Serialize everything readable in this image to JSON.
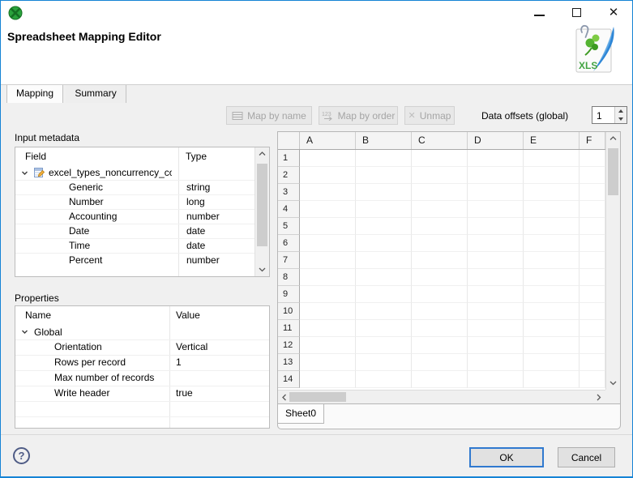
{
  "window": {
    "icons": {
      "app": "clover-app-icon",
      "minimize": "minimize-icon",
      "maximize": "maximize-icon",
      "close": "close-icon"
    },
    "close_glyph": "✕"
  },
  "header": {
    "title": "Spreadsheet Mapping Editor",
    "file_icon_label": "XLS"
  },
  "tabs": {
    "mapping": "Mapping",
    "summary": "Summary"
  },
  "toolbar": {
    "map_by_name": "Map by name",
    "map_by_order": "Map by order",
    "unmap": "Unmap",
    "unmap_glyph": "✕",
    "data_offsets_label": "Data offsets (global)",
    "data_offsets_value": "1"
  },
  "input_metadata": {
    "section_label": "Input metadata",
    "columns": {
      "field": "Field",
      "type": "Type"
    },
    "record_name": "excel_types_noncurrency_con",
    "fields": [
      {
        "field": "Generic",
        "type": "string"
      },
      {
        "field": "Number",
        "type": "long"
      },
      {
        "field": "Accounting",
        "type": "number"
      },
      {
        "field": "Date",
        "type": "date"
      },
      {
        "field": "Time",
        "type": "date"
      },
      {
        "field": "Percent",
        "type": "number"
      }
    ]
  },
  "properties": {
    "section_label": "Properties",
    "columns": {
      "name": "Name",
      "value": "Value"
    },
    "group": "Global",
    "rows": [
      {
        "name": "Orientation",
        "value": "Vertical"
      },
      {
        "name": "Rows per record",
        "value": "1"
      },
      {
        "name": "Max number of records",
        "value": ""
      },
      {
        "name": "Write header",
        "value": "true"
      }
    ]
  },
  "grid": {
    "column_headers": [
      "A",
      "B",
      "C",
      "D",
      "E",
      "F"
    ],
    "row_headers": [
      "1",
      "2",
      "3",
      "4",
      "5",
      "6",
      "7",
      "8",
      "9",
      "10",
      "11",
      "12",
      "13",
      "14"
    ],
    "sheet_tab": "Sheet0"
  },
  "footer": {
    "help": "?",
    "ok": "OK",
    "cancel": "Cancel"
  },
  "colors": {
    "accent": "#1583d5",
    "disabled_text": "#a5a5a5",
    "window_border": "#1583d5",
    "panel_bg": "#f0f0f0"
  }
}
